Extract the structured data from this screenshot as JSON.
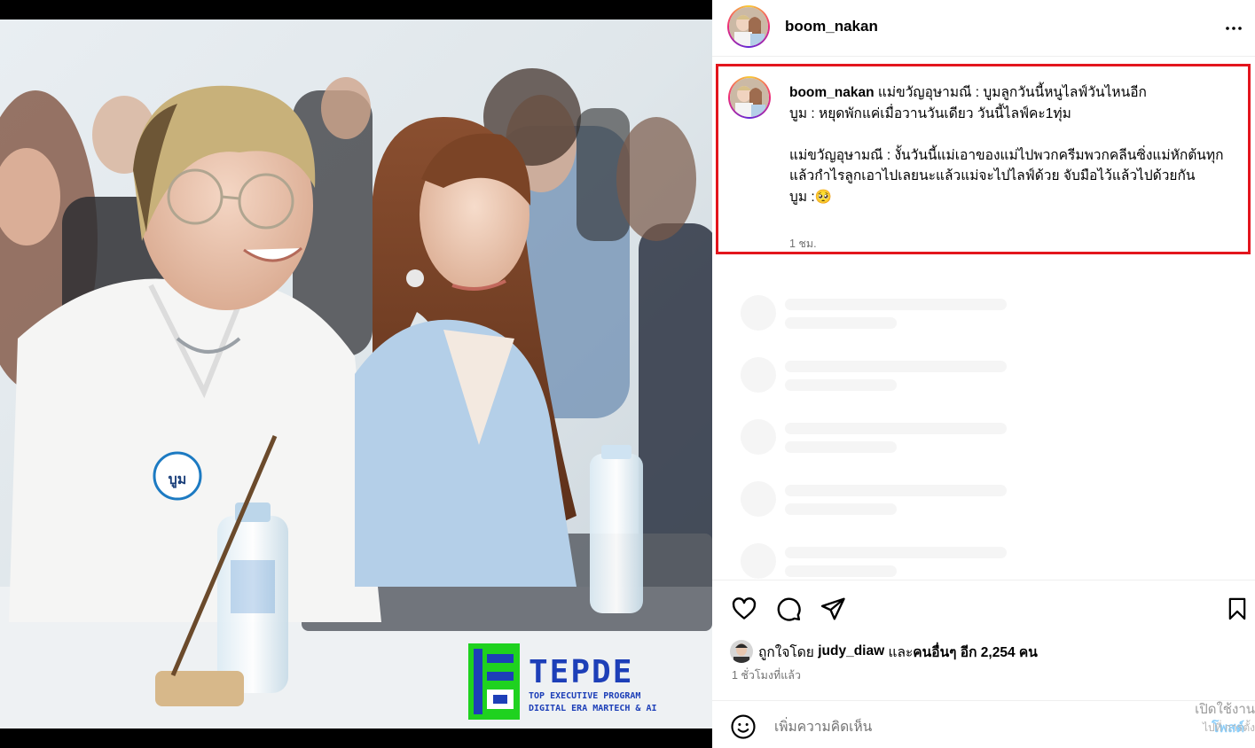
{
  "post": {
    "username": "boom_nakan",
    "more_icon": "more-horizontal-icon"
  },
  "caption": {
    "username": "boom_nakan",
    "line1": "แม่ขวัญอุษามณี : บูมลูกวันนี้หนูไลฟ์วันไหนอีก",
    "line2": "บูม : หยุดพักแค่เมื่อวานวันเดียว วันนี้ไลฟ์คะ1ทุ่ม",
    "line3": "แม่ขวัญอุษามณี : งั้นวันนี้แม่เอาของแม่ไปพวกครีมพวกคลีนซิ่งแม่หักต้นทุกแล้วกำไรลูกเอาไปเลยนะแล้วแม่จะไปไลฟ์ด้วย จับมือไว้แล้วไปด้วยกัน",
    "line4": "บูม :",
    "line4_emoji": "🥺",
    "time": "1 ชม.",
    "highlight_color": "#e3151d"
  },
  "photo": {
    "badge_text": "บูม",
    "logo_text": "TEPDE",
    "logo_sub1": "TOP EXECUTIVE PROGRAM",
    "logo_sub2": "DIGITAL ERA MARTECH & AI"
  },
  "actions": {
    "like_icon": "heart-icon",
    "comment_icon": "comment-icon",
    "share_icon": "send-icon",
    "save_icon": "bookmark-icon"
  },
  "likes": {
    "prefix": "ถูกใจโดย",
    "user": "judy_diaw",
    "middle": "และ",
    "others": "คนอื่นๆ อีก 2,254 คน"
  },
  "post_time": "1 ชั่วโมงที่แล้ว",
  "comment": {
    "placeholder": "เพิ่มความคิดเห็น",
    "post_label": "โพสต์",
    "emoji_icon": "smiley-icon"
  },
  "watermark": {
    "line1": "เปิดใช้งาน",
    "line2": "ไปที่ การตั้ง"
  },
  "colors": {
    "accent": "#0095f6",
    "highlight": "#e3151d",
    "muted": "#737373"
  }
}
